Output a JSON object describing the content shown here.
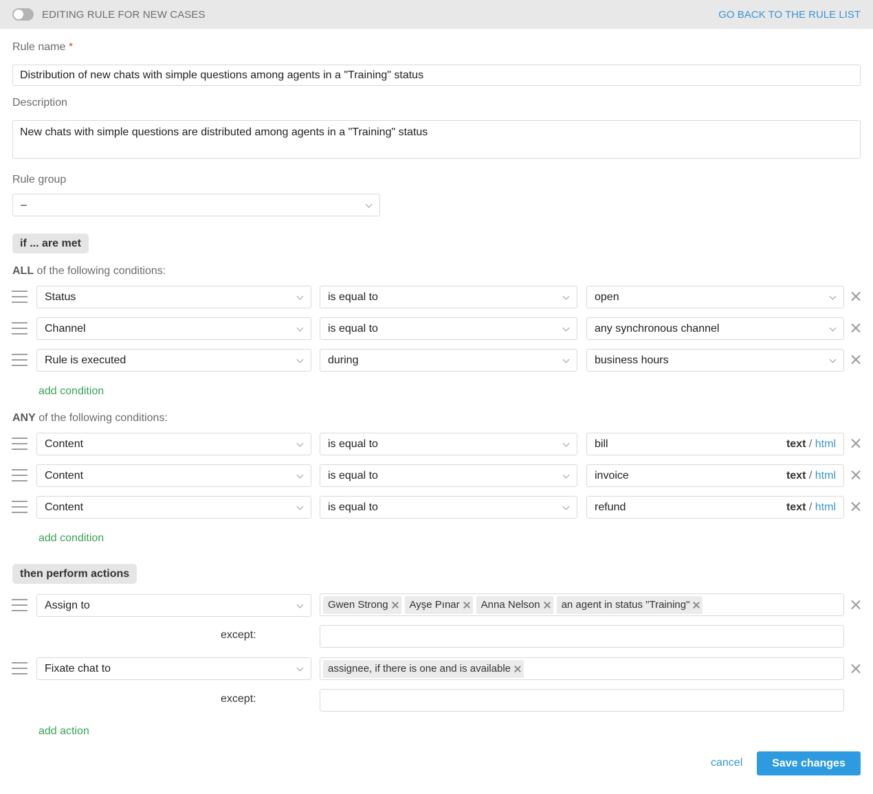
{
  "header": {
    "title": "EDITING RULE FOR NEW CASES",
    "back_link": "GO BACK TO THE RULE LIST"
  },
  "form": {
    "rule_name_label": "Rule name",
    "rule_name_required": "*",
    "rule_name_value": "Distribution of new chats with simple questions among agents in a \"Training\" status",
    "description_label": "Description",
    "description_value": "New chats with simple questions are distributed among agents in a \"Training\" status",
    "rule_group_label": "Rule group",
    "rule_group_value": "–"
  },
  "conditions": {
    "header": "if ... are met",
    "all": {
      "prefix": "ALL",
      "suffix": " of the following conditions:",
      "rows": [
        {
          "field": "Status",
          "operator": "is equal to",
          "value": "open"
        },
        {
          "field": "Channel",
          "operator": "is equal to",
          "value": "any synchronous channel"
        },
        {
          "field": "Rule is executed",
          "operator": "during",
          "value": "business hours"
        }
      ],
      "add_label": "add condition"
    },
    "any": {
      "prefix": "ANY",
      "suffix": " of the following conditions:",
      "rows": [
        {
          "field": "Content",
          "operator": "is equal to",
          "value": "bill"
        },
        {
          "field": "Content",
          "operator": "is equal to",
          "value": "invoice"
        },
        {
          "field": "Content",
          "operator": "is equal to",
          "value": "refund"
        }
      ],
      "format_text": "text",
      "format_sep": "/",
      "format_html": "html",
      "add_label": "add condition"
    }
  },
  "actions": {
    "header": "then perform actions",
    "rows": [
      {
        "action": "Assign to",
        "tags": [
          "Gwen Strong",
          "Ayşe Pınar",
          "Anna Nelson",
          "an agent in status \"Training\""
        ],
        "except_label": "except:"
      },
      {
        "action": "Fixate chat to",
        "tags": [
          "assignee, if there is one and is available"
        ],
        "except_label": "except:"
      }
    ],
    "add_label": "add action"
  },
  "footer": {
    "cancel_label": "cancel",
    "save_label": "Save changes"
  },
  "colors": {
    "accent_blue": "#2e9be0",
    "link_blue": "#3a95d3",
    "add_green": "#3aa255",
    "required_red": "#e04a3c"
  }
}
